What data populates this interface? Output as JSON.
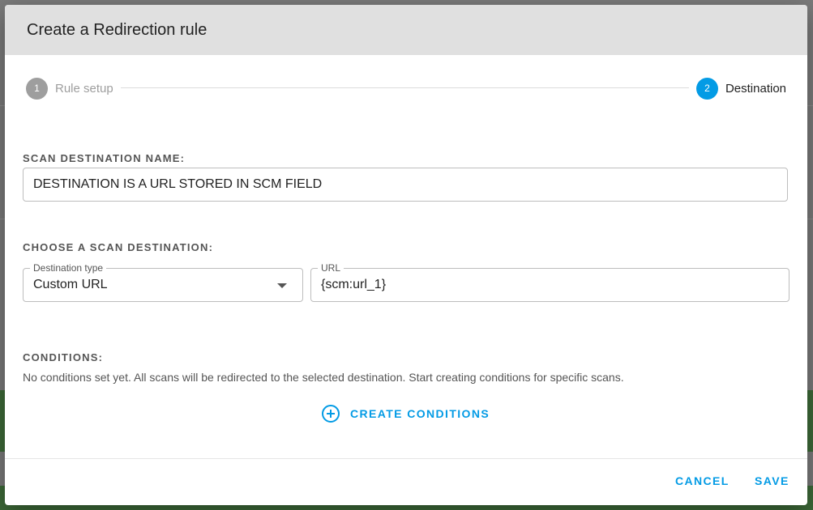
{
  "dialog": {
    "title": "Create a Redirection rule"
  },
  "stepper": {
    "steps": [
      {
        "number": "1",
        "label": "Rule setup",
        "state": "completed"
      },
      {
        "number": "2",
        "label": "Destination",
        "state": "active"
      }
    ]
  },
  "scan_destination_name": {
    "label": "SCAN DESTINATION NAME:",
    "value": "DESTINATION IS A URL STORED IN SCM FIELD"
  },
  "scan_destination": {
    "label": "CHOOSE A SCAN DESTINATION:",
    "destination_type": {
      "label": "Destination type",
      "selected": "Custom URL"
    },
    "url": {
      "label": "URL",
      "value": "{scm:url_1}"
    }
  },
  "conditions": {
    "label": "CONDITIONS:",
    "help_text": "No conditions set yet. All scans will be redirected to the selected destination. Start creating conditions for specific scans.",
    "create_label": "CREATE CONDITIONS"
  },
  "footer": {
    "cancel_label": "CANCEL",
    "save_label": "SAVE"
  },
  "colors": {
    "accent": "#039be5",
    "inactive_step": "#9e9e9e",
    "header_bg": "#e0e0e0"
  },
  "icons": {
    "create_conditions": "plus-circle-icon",
    "select_caret": "caret-down-icon"
  }
}
